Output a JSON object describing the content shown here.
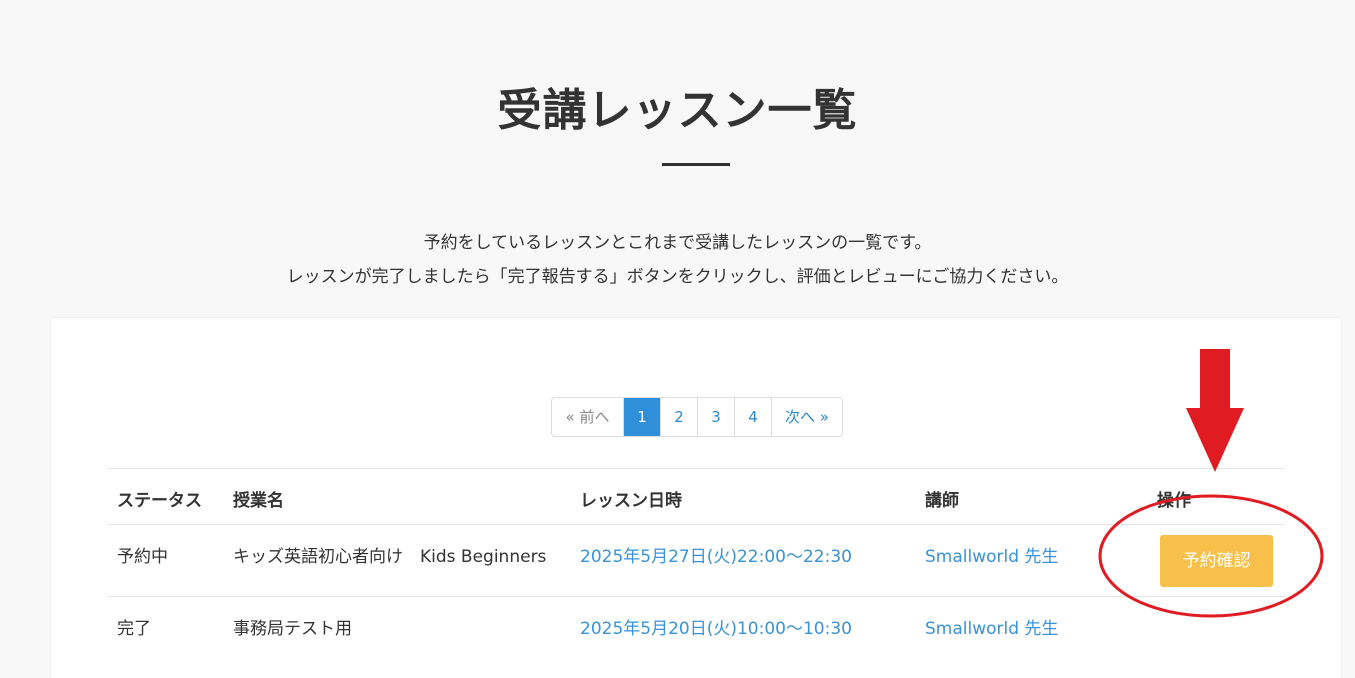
{
  "page": {
    "title": "受講レッスン一覧",
    "intro_line1": "予約をしているレッスンとこれまで受講したレッスンの一覧です。",
    "intro_line2": "レッスンが完了しましたら「完了報告する」ボタンをクリックし、評価とレビューにご協力ください。"
  },
  "pagination": {
    "prev": "« 前へ",
    "pages": [
      "1",
      "2",
      "3",
      "4"
    ],
    "current": "1",
    "next": "次へ »"
  },
  "table": {
    "headers": {
      "status": "ステータス",
      "course": "授業名",
      "datetime": "レッスン日時",
      "teacher": "講師",
      "action": "操作"
    },
    "rows": [
      {
        "status": "予約中",
        "course": "キッズ英語初心者向け　Kids Beginners",
        "datetime": "2025年5月27日(火)22:00〜22:30",
        "teacher": "Smallworld 先生",
        "action_label": "予約確認"
      },
      {
        "status": "完了",
        "course": "事務局テスト用",
        "datetime": "2025年5月20日(火)10:00〜10:30",
        "teacher": "Smallworld 先生",
        "action_label": ""
      }
    ]
  },
  "colors": {
    "accent_blue": "#2f8fd8",
    "link_blue": "#3a92d8",
    "button_yellow": "#f7c04a",
    "annotation_red": "#e01b22"
  },
  "annotations": {
    "arrow": "red-down-arrow",
    "ellipse": "red-ellipse-highlight"
  }
}
